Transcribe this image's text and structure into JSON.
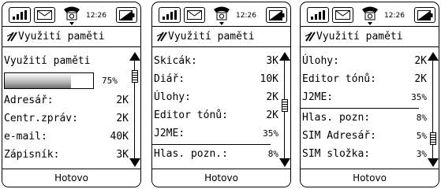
{
  "screens": [
    {
      "status": {
        "time": "12:26"
      },
      "title": "Využití paměti",
      "softkey": "Hotovo",
      "header_label": "Využití paměti",
      "progress": {
        "percent_label": "75%",
        "value": 0.75
      },
      "rows": [
        {
          "label": "Adresář:",
          "value": "2K"
        },
        {
          "label": "Centr.zpráv:",
          "value": "2K"
        },
        {
          "label": "e-mail:",
          "value": "40K"
        },
        {
          "label": "Zápisník:",
          "value": "3K"
        }
      ],
      "scroll_position": 0.1
    },
    {
      "status": {
        "time": "12:26"
      },
      "title": "Využití paměti",
      "softkey": "Hotovo",
      "rows": [
        {
          "label": "Skicák:",
          "value": "3K"
        },
        {
          "label": "Diář:",
          "value": "10K"
        },
        {
          "label": "Úlohy:",
          "value": "2K"
        },
        {
          "label": "Editor tónů:",
          "value": "2K"
        },
        {
          "label": "J2ME:",
          "value": "35%"
        },
        {
          "label": "Hlas. pozn.:",
          "value": "8%"
        }
      ],
      "scroll_position": 0.45
    },
    {
      "status": {
        "time": "12:26"
      },
      "title": "Využití paměti",
      "softkey": "Hotovo",
      "rows": [
        {
          "label": "Úlohy:",
          "value": "2K"
        },
        {
          "label": "Editor tónů:",
          "value": "2K"
        },
        {
          "label": "J2ME:",
          "value": "35%"
        },
        {
          "label": "Hlas. pozn:",
          "value": "8%"
        },
        {
          "label": "SIM Adresář:",
          "value": "5%"
        },
        {
          "label": "SIM složka:",
          "value": "3%"
        }
      ],
      "scroll_position": 0.85
    }
  ],
  "icons": [
    "signal-strength-icon",
    "envelope-icon",
    "phone-icon",
    "battery-icon",
    "memory-icon",
    "scroll-up-arrow-icon",
    "scroll-down-arrow-icon"
  ]
}
